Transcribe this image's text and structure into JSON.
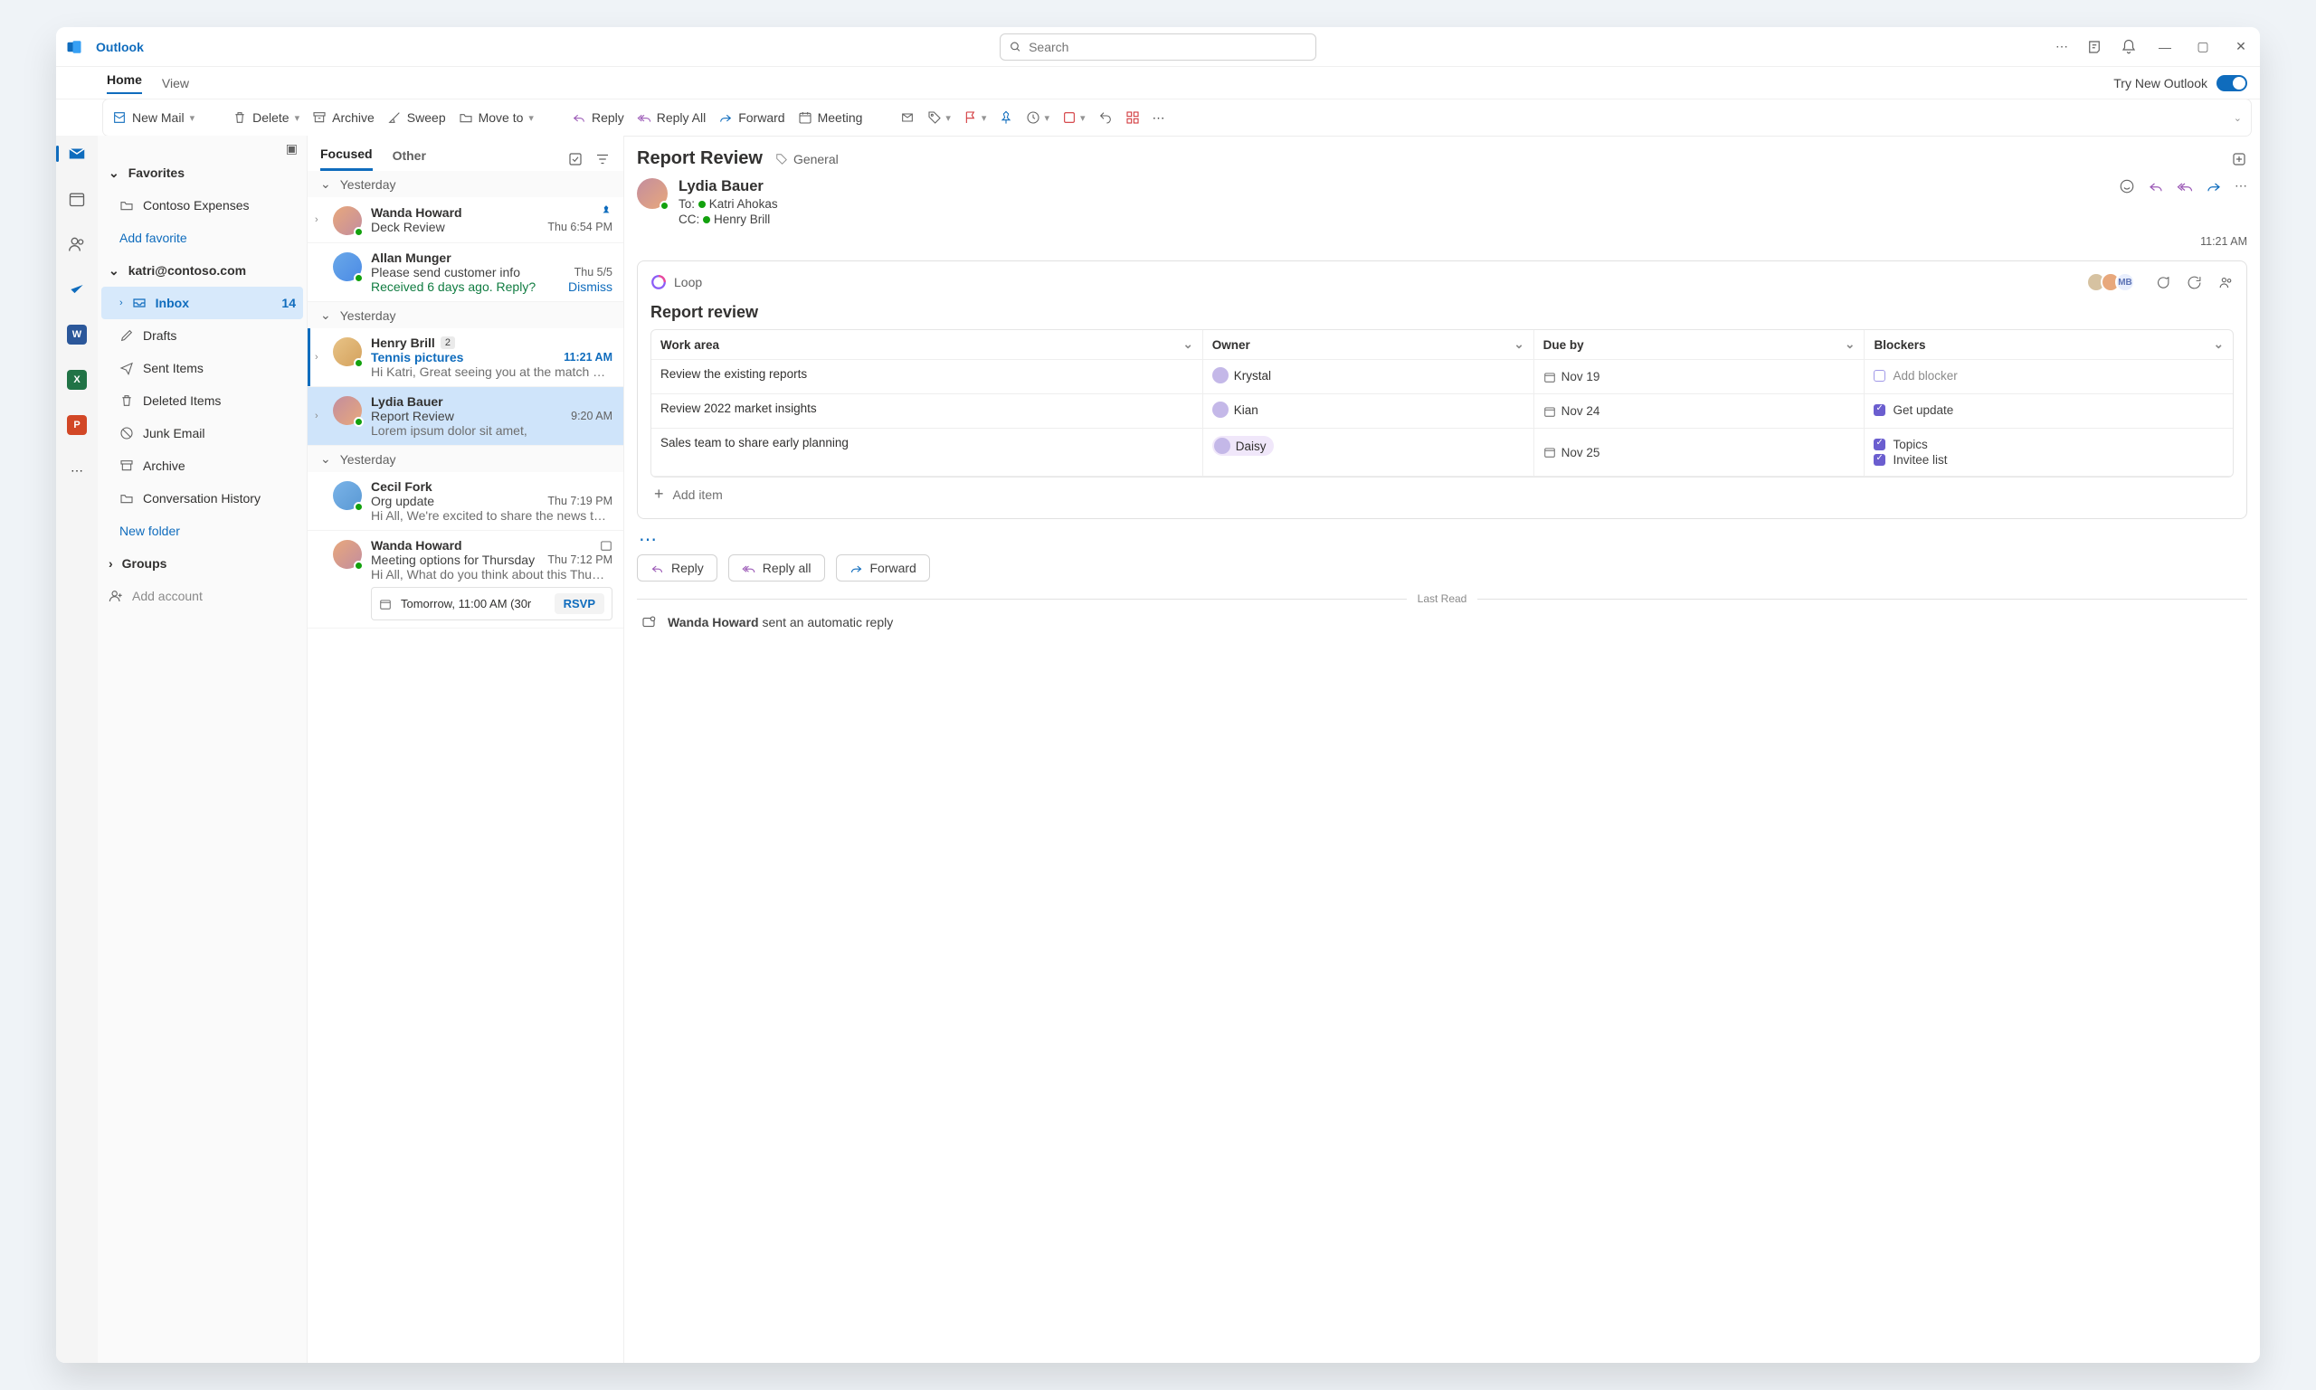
{
  "app": {
    "name": "Outlook"
  },
  "search": {
    "placeholder": "Search"
  },
  "tabs": {
    "home": "Home",
    "view": "View"
  },
  "try": "Try New Outlook",
  "ribbon": {
    "newMail": "New Mail",
    "delete": "Delete",
    "archive": "Archive",
    "sweep": "Sweep",
    "moveTo": "Move to",
    "reply": "Reply",
    "replyAll": "Reply All",
    "forward": "Forward",
    "meeting": "Meeting"
  },
  "folders": {
    "favorites": "Favorites",
    "contosoExpenses": "Contoso Expenses",
    "addFavorite": "Add favorite",
    "account": "katri@contoso.com",
    "inbox": "Inbox",
    "inboxCount": "14",
    "drafts": "Drafts",
    "sent": "Sent Items",
    "deleted": "Deleted Items",
    "junk": "Junk Email",
    "archive": "Archive",
    "convHistory": "Conversation History",
    "newFolder": "New folder",
    "groups": "Groups",
    "addAccount": "Add account"
  },
  "ml": {
    "focused": "Focused",
    "other": "Other",
    "groupYesterday": "Yesterday",
    "m1": {
      "from": "Wanda Howard",
      "subj": "Deck Review",
      "time": "Thu 6:54 PM"
    },
    "m2": {
      "from": "Allan Munger",
      "subj": "Please send customer info",
      "time": "Thu 5/5",
      "nudge": "Received 6 days ago. Reply?",
      "dismiss": "Dismiss"
    },
    "m3": {
      "from": "Henry Brill",
      "badge": "2",
      "subj": "Tennis pictures",
      "time": "11:21 AM",
      "prev": "Hi Katri, Great seeing you at the match t…"
    },
    "m4": {
      "from": "Lydia Bauer",
      "subj": "Report Review",
      "time": "9:20 AM",
      "prev": "Lorem ipsum dolor sit amet,"
    },
    "m5": {
      "from": "Cecil Fork",
      "subj": "Org update",
      "time": "Thu 7:19 PM",
      "prev": "Hi All, We're excited to share the news t…"
    },
    "m6": {
      "from": "Wanda Howard",
      "subj": "Meeting options for Thursday",
      "time": "Thu 7:12 PM",
      "prev": "Hi All, What do you think about this Thu…",
      "event": "Tomorrow, 11:00 AM (30r",
      "rsvp": "RSVP"
    }
  },
  "read": {
    "title": "Report Review",
    "category": "General",
    "senderName": "Lydia Bauer",
    "toLabel": "To:",
    "toName": "Katri Ahokas",
    "ccLabel": "CC:",
    "ccName": "Henry Brill",
    "timestamp": "11:21 AM",
    "loopLabel": "Loop",
    "loopTitle": "Report review",
    "headers": {
      "workArea": "Work area",
      "owner": "Owner",
      "dueBy": "Due by",
      "blockers": "Blockers"
    },
    "rows": [
      {
        "wa": "Review the existing reports",
        "owner": "Krystal",
        "due": "Nov 19",
        "blockers": [
          {
            "t": "Add blocker",
            "c": false,
            "ghost": true
          }
        ]
      },
      {
        "wa": "Review 2022 market insights",
        "owner": "Kian",
        "due": "Nov 24",
        "blockers": [
          {
            "t": "Get update",
            "c": true
          }
        ]
      },
      {
        "wa": "Sales team to share early planning",
        "owner": "Daisy",
        "due": "Nov 25",
        "blockers": [
          {
            "t": "Topics",
            "c": true
          },
          {
            "t": "Invitee list",
            "c": true
          }
        ]
      }
    ],
    "addItem": "Add item",
    "replyBtn": "Reply",
    "replyAllBtn": "Reply all",
    "forwardBtn": "Forward",
    "lastRead": "Last Read",
    "autoReply1": "Wanda Howard",
    "autoReply2": " sent an automatic reply",
    "facepileInitials": "MB"
  }
}
